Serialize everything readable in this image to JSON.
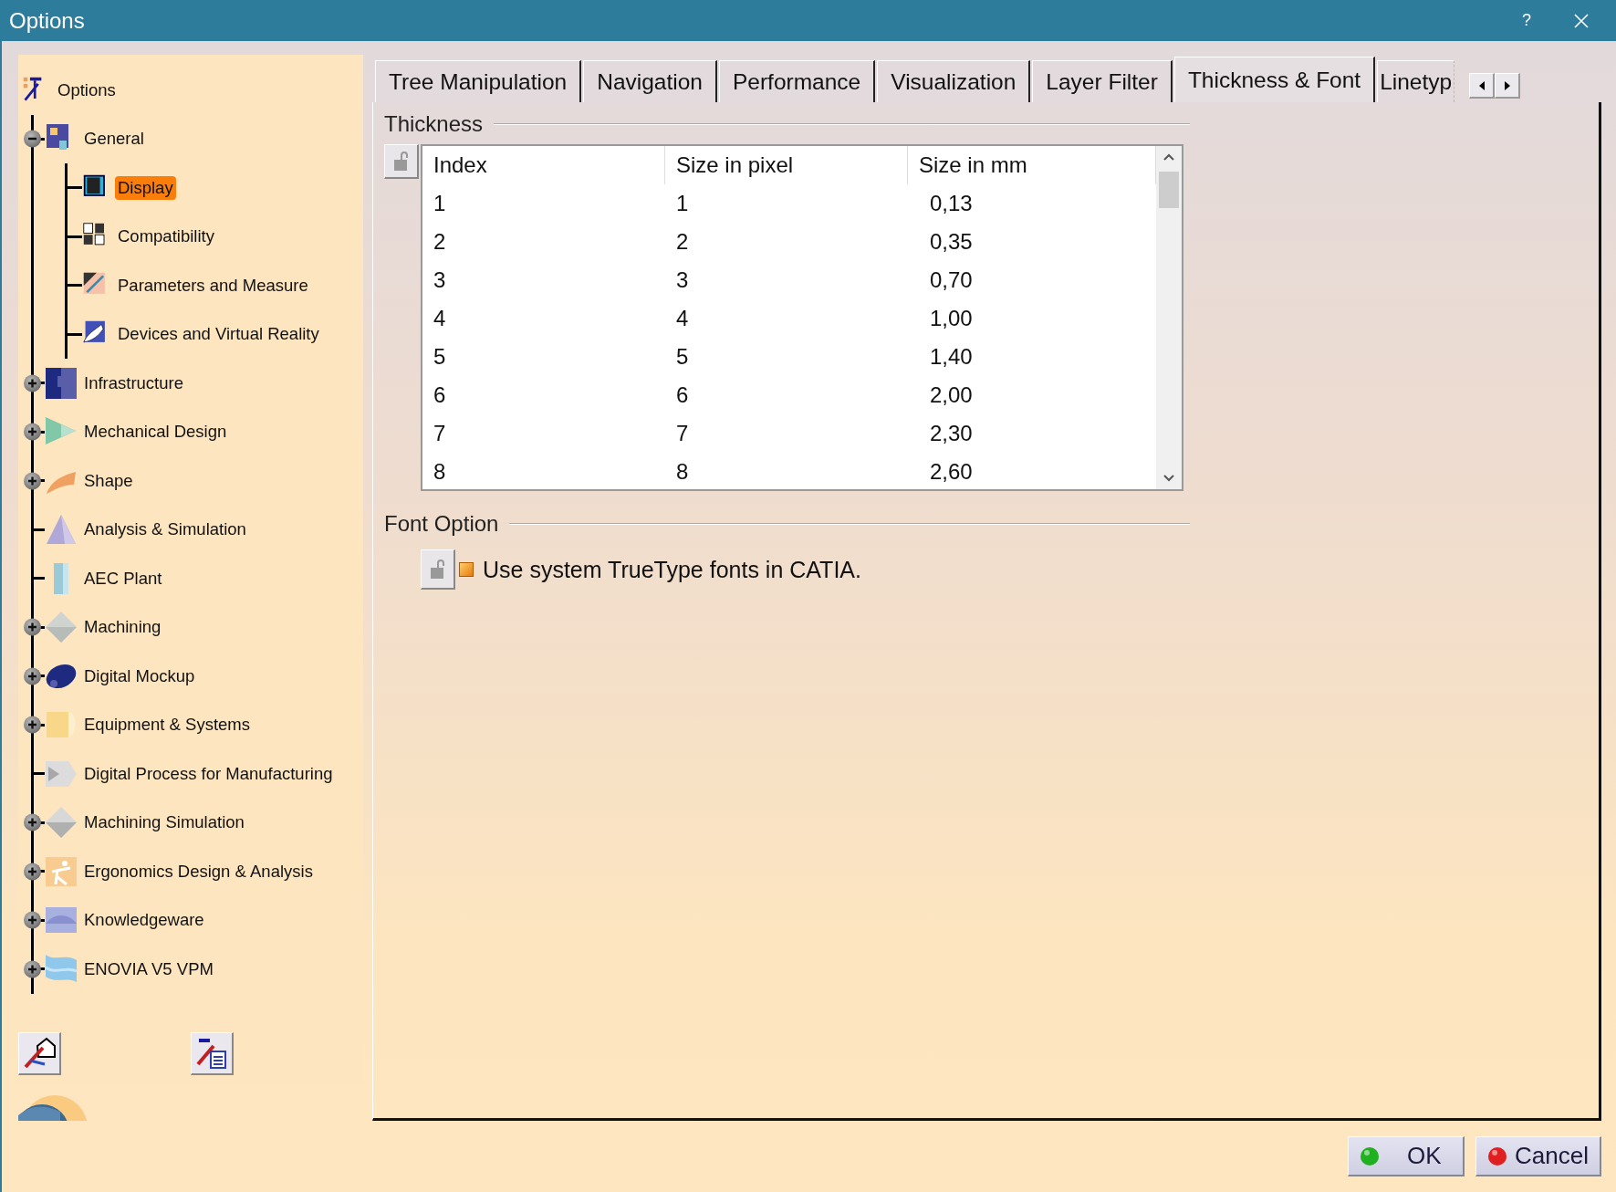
{
  "window": {
    "title": "Options",
    "help": "?"
  },
  "tree": {
    "label": "Options",
    "selected": false,
    "children": [
      {
        "label": "General",
        "selected": false,
        "expanded": true,
        "children": [
          {
            "label": "Display",
            "selected": true
          },
          {
            "label": "Compatibility",
            "selected": false
          },
          {
            "label": "Parameters and Measure",
            "selected": false
          },
          {
            "label": "Devices and Virtual Reality",
            "selected": false
          }
        ]
      },
      {
        "label": "Infrastructure",
        "selected": false,
        "expanded": false
      },
      {
        "label": "Mechanical Design",
        "selected": false,
        "expanded": false
      },
      {
        "label": "Shape",
        "selected": false,
        "expanded": false
      },
      {
        "label": "Analysis & Simulation",
        "selected": false
      },
      {
        "label": "AEC Plant",
        "selected": false
      },
      {
        "label": "Machining",
        "selected": false,
        "expanded": false
      },
      {
        "label": "Digital Mockup",
        "selected": false,
        "expanded": false
      },
      {
        "label": "Equipment & Systems",
        "selected": false,
        "expanded": false
      },
      {
        "label": "Digital Process for Manufacturing",
        "selected": false
      },
      {
        "label": "Machining Simulation",
        "selected": false,
        "expanded": false
      },
      {
        "label": "Ergonomics Design & Analysis",
        "selected": false,
        "expanded": false
      },
      {
        "label": "Knowledgeware",
        "selected": false,
        "expanded": false
      },
      {
        "label": "ENOVIA V5 VPM",
        "selected": false,
        "expanded": false
      }
    ]
  },
  "tabs": [
    {
      "label": "Tree Manipulation",
      "selected": false
    },
    {
      "label": "Navigation",
      "selected": false
    },
    {
      "label": "Performance",
      "selected": false
    },
    {
      "label": "Visualization",
      "selected": false
    },
    {
      "label": "Layer Filter",
      "selected": false
    },
    {
      "label": "Thickness & Font",
      "selected": true
    },
    {
      "label": "Linetyp",
      "selected": false
    }
  ],
  "thickness": {
    "title": "Thickness",
    "columns": [
      "Index",
      "Size in pixel",
      "Size in mm"
    ],
    "rows": [
      [
        "1",
        "1",
        "0,13"
      ],
      [
        "2",
        "2",
        "0,35"
      ],
      [
        "3",
        "3",
        "0,70"
      ],
      [
        "4",
        "4",
        "1,00"
      ],
      [
        "5",
        "5",
        "1,40"
      ],
      [
        "6",
        "6",
        "2,00"
      ],
      [
        "7",
        "7",
        "2,30"
      ],
      [
        "8",
        "8",
        "2,60"
      ]
    ]
  },
  "font_option": {
    "title": "Font Option",
    "checkbox": {
      "label": "Use system TrueType fonts in CATIA.",
      "checked": true
    }
  },
  "buttons": [
    {
      "kind": "ok",
      "label": "OK"
    },
    {
      "kind": "cancel",
      "label": "Cancel"
    }
  ]
}
